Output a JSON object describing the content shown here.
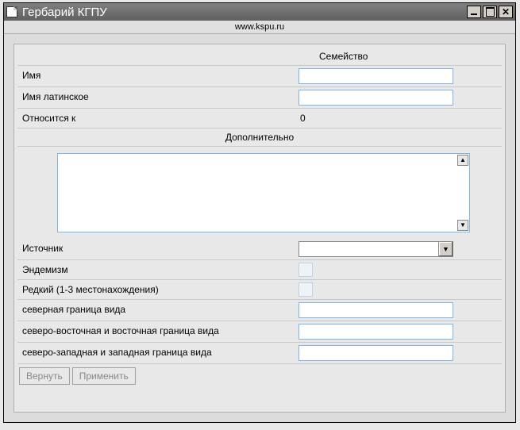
{
  "window": {
    "title": "Гербарий КГПУ",
    "url": "www.kspu.ru"
  },
  "form": {
    "header_family": "Семейство",
    "name_label": "Имя",
    "name_value": "",
    "latin_label": "Имя латинское",
    "latin_value": "",
    "belongs_label": "Относится к",
    "belongs_value": "0",
    "additional_header": "Дополнительно",
    "additional_value": "",
    "source_label": "Источник",
    "source_value": "",
    "endemism_label": "Эндемизм",
    "rare_label": "Редкий (1-3 местонахождения)",
    "north_label": "северная граница вида",
    "north_value": "",
    "northeast_label": "северо-восточная и восточная граница вида",
    "northeast_value": "",
    "northwest_label": "северо-западная и западная граница вида",
    "northwest_value": ""
  },
  "buttons": {
    "revert": "Вернуть",
    "apply": "Применить"
  }
}
